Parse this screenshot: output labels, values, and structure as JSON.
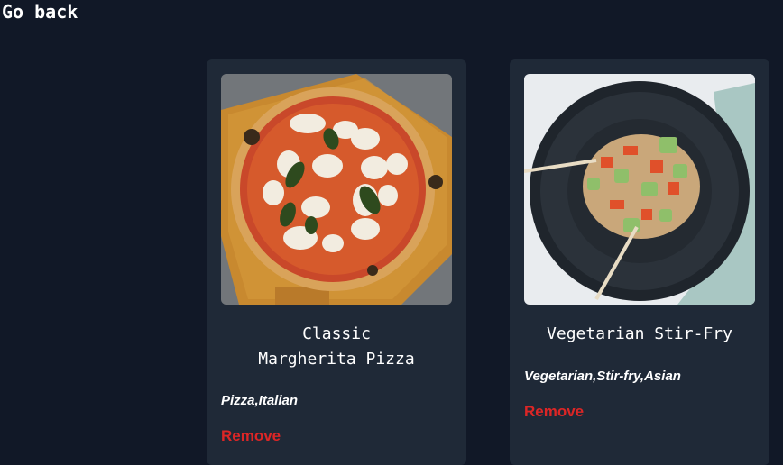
{
  "nav": {
    "back_label": "Go back"
  },
  "recipes": [
    {
      "title_line1": "Classic",
      "title_line2": "Margherita Pizza",
      "tags": "Pizza,Italian",
      "remove_label": "Remove"
    },
    {
      "title": "Vegetarian Stir-Fry",
      "tags": "Vegetarian,Stir-fry,Asian",
      "remove_label": "Remove"
    }
  ],
  "colors": {
    "background": "#111827",
    "card": "#1f2937",
    "remove": "#dc2626",
    "text": "#ffffff"
  }
}
